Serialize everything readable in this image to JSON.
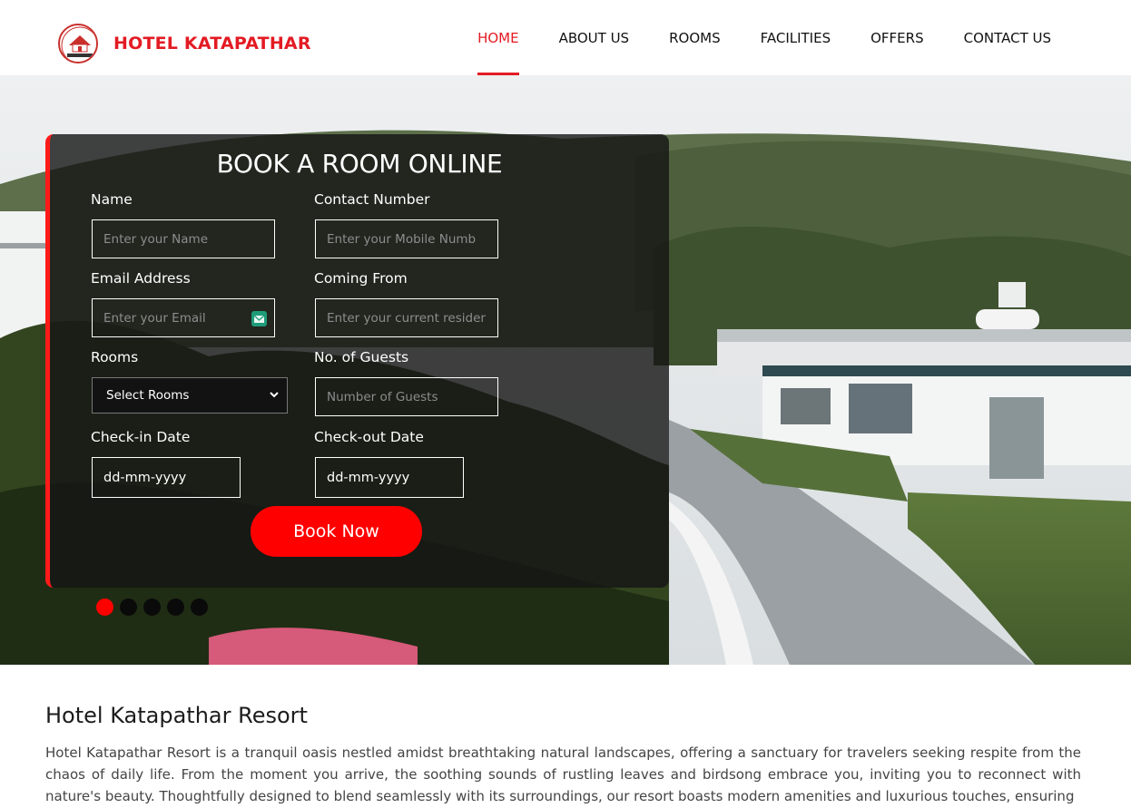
{
  "header": {
    "brand": "HOTEL KATAPATHAR",
    "logo_text": "Hotel Katapathar Resort",
    "nav": [
      {
        "label": "HOME",
        "active": true
      },
      {
        "label": "ABOUT US",
        "active": false
      },
      {
        "label": "ROOMS",
        "active": false
      },
      {
        "label": "FACILITIES",
        "active": false
      },
      {
        "label": "OFFERS",
        "active": false
      },
      {
        "label": "CONTACT US",
        "active": false
      }
    ]
  },
  "booking": {
    "title": "BOOK A ROOM ONLINE",
    "name": {
      "label": "Name",
      "placeholder": "Enter your Name"
    },
    "contact": {
      "label": "Contact Number",
      "placeholder": "Enter your Mobile Numb"
    },
    "email": {
      "label": "Email Address",
      "placeholder": "Enter your Email",
      "icon": "mail-icon"
    },
    "coming_from": {
      "label": "Coming From",
      "placeholder": "Enter your current resider"
    },
    "rooms": {
      "label": "Rooms",
      "selected": "Select Rooms",
      "icon": "chevron-down-icon"
    },
    "guests": {
      "label": "No. of Guests",
      "placeholder": "Number of Guests"
    },
    "checkin": {
      "label": "Check-in Date",
      "value": "dd-mm-yyyy"
    },
    "checkout": {
      "label": "Check-out Date",
      "value": "dd-mm-yyyy"
    },
    "submit_label": "Book Now"
  },
  "slider": {
    "count": 5,
    "active_index": 0
  },
  "intro": {
    "title": "Hotel Katapathar Resort",
    "text": "Hotel Katapathar Resort is a tranquil oasis nestled amidst breathtaking natural landscapes, offering a sanctuary for travelers seeking respite from the chaos of daily life. From the moment you arrive, the soothing sounds of rustling leaves and birdsong embrace you, inviting you to reconnect with nature's beauty. Thoughtfully designed to blend seamlessly with its surroundings, our resort boasts modern amenities and luxurious touches, ensuring"
  },
  "colors": {
    "accent": "#e31b23",
    "button": "#ff0000",
    "card": "#141414"
  }
}
